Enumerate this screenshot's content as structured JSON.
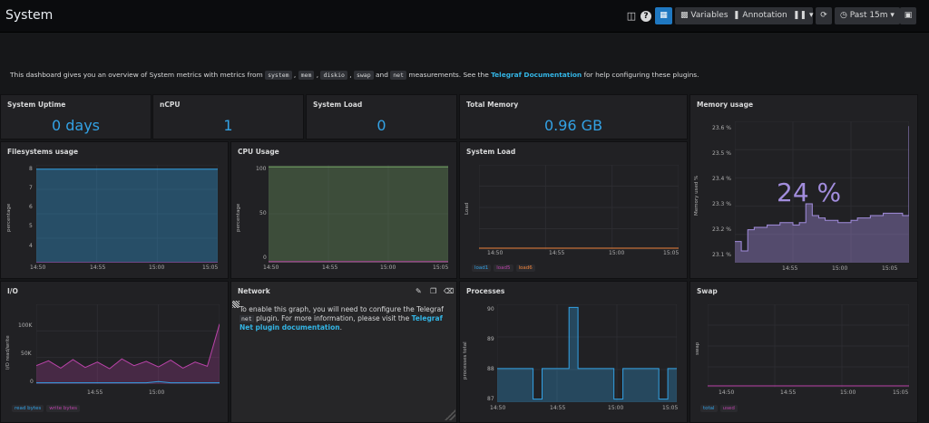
{
  "header": {
    "title": "System",
    "variables_label": "Variables",
    "annotations_label": "Annotations",
    "time_range": "Past 15m"
  },
  "intro": {
    "text_before": "This dashboard gives you an overview of System metrics with metrics from",
    "codes": [
      "system",
      "mem",
      "diskio",
      "swap",
      "net"
    ],
    "and": "and",
    "text_after": "measurements. See the",
    "link": "Telegraf Documentation",
    "text_end": "for help configuring these plugins."
  },
  "stats": {
    "uptime": {
      "title": "System Uptime",
      "value": "0 days"
    },
    "ncpu": {
      "title": "nCPU",
      "value": "1"
    },
    "load": {
      "title": "System Load",
      "value": "0"
    },
    "memory": {
      "title": "Total Memory",
      "value": "0.96 GB"
    }
  },
  "memory_usage": {
    "title": "Memory usage",
    "big_value": "24 %",
    "ylabel": "Memory used %"
  },
  "filesystems": {
    "title": "Filesystems usage",
    "ylabel": "percentage"
  },
  "cpu": {
    "title": "CPU Usage",
    "ylabel": "percentage"
  },
  "sysload": {
    "title": "System Load",
    "ylabel": "Load",
    "legend": [
      "load1",
      "load5",
      "load6"
    ]
  },
  "io": {
    "title": "I/O",
    "ylabel": "I/O read/write",
    "legend": [
      "read bytes",
      "write bytes"
    ]
  },
  "network": {
    "title": "Network",
    "text1": "To enable this graph, you will need to configure the Telegraf",
    "code": "net",
    "text2": "plugin. For more information, please visit the",
    "link": "Telegraf Net plugin documentation",
    "end": "."
  },
  "processes": {
    "title": "Processes",
    "ylabel": "processes total"
  },
  "swap": {
    "title": "Swap",
    "ylabel": "swap",
    "legend": [
      "total",
      "used"
    ]
  },
  "colors": {
    "blue": "#33a2e5",
    "purple": "#a28ddd",
    "green": "#7eb26d",
    "magenta": "#ba43a9",
    "orange": "#ef843c"
  },
  "chart_data": [
    {
      "type": "area",
      "title": "Filesystems usage",
      "ylabel": "percentage",
      "x": [
        "14:50",
        "14:55",
        "15:00",
        "15:05"
      ],
      "yticks": [
        "8",
        "7",
        "6",
        "5",
        "4"
      ],
      "ylim": [
        3.6,
        8.2
      ],
      "series": [
        {
          "values": [
            8,
            8,
            8,
            8
          ]
        },
        {
          "values": [
            3.6,
            3.6,
            3.6,
            3.6
          ]
        }
      ]
    },
    {
      "type": "area",
      "title": "CPU Usage",
      "ylabel": "percentage",
      "x": [
        "14:50",
        "14:55",
        "15:00",
        "15:05"
      ],
      "yticks": [
        "100",
        "50",
        "0"
      ],
      "ylim": [
        0,
        100
      ],
      "series": [
        {
          "values": [
            98,
            98,
            98,
            98
          ]
        },
        {
          "values": [
            1,
            1,
            1,
            1
          ]
        }
      ]
    },
    {
      "type": "line",
      "title": "System Load",
      "ylabel": "Load",
      "x": [
        "14:50",
        "14:55",
        "15:00",
        "15:05"
      ],
      "series": [
        {
          "name": "load1",
          "values": [
            0,
            0,
            0,
            0
          ]
        },
        {
          "name": "load5",
          "values": [
            0,
            0,
            0,
            0
          ]
        },
        {
          "name": "load6",
          "values": [
            0,
            0,
            0,
            0
          ]
        }
      ]
    },
    {
      "type": "area",
      "title": "Memory usage",
      "ylabel": "Memory used %",
      "x": [
        "14:55",
        "15:00",
        "15:05"
      ],
      "yticks": [
        "23.6 %",
        "23.5 %",
        "23.4 %",
        "23.3 %",
        "23.2 %",
        "23.1 %"
      ],
      "ylim": [
        23.05,
        23.65
      ],
      "values": [
        23.14,
        23.1,
        23.19,
        23.2,
        23.2,
        23.21,
        23.21,
        23.22,
        23.22,
        23.21,
        23.22,
        23.3,
        23.25,
        23.24,
        23.23,
        23.23,
        23.22,
        23.22,
        23.23,
        23.24,
        23.24,
        23.25,
        23.25,
        23.26,
        23.26,
        23.26,
        23.25,
        23.63
      ]
    },
    {
      "type": "line",
      "title": "I/O",
      "ylabel": "I/O read/write",
      "x": [
        "14:55",
        "15:00"
      ],
      "yticks": [
        "100K",
        "50K",
        "0"
      ],
      "ylim": [
        0,
        130000
      ],
      "series": [
        {
          "name": "read bytes",
          "values": [
            2000,
            2000,
            2000,
            2000,
            2000,
            2000,
            2000,
            2000,
            2000,
            2000,
            4000,
            2000,
            2000,
            2000,
            2000,
            2000
          ]
        },
        {
          "name": "write bytes",
          "values": [
            30000,
            38000,
            26000,
            40000,
            27000,
            36000,
            25000,
            41000,
            30000,
            37000,
            28000,
            39000,
            26000,
            36000,
            29000,
            98000
          ]
        }
      ]
    },
    {
      "type": "line",
      "title": "Processes",
      "ylabel": "processes total",
      "x": [
        "14:50",
        "14:55",
        "15:00",
        "15:05"
      ],
      "yticks": [
        "90",
        "89",
        "88",
        "87"
      ],
      "ylim": [
        86.9,
        90.1
      ],
      "values": [
        88,
        88,
        88,
        88,
        87,
        88,
        88,
        88,
        90,
        88,
        88,
        88,
        88,
        87,
        88,
        88,
        88,
        88,
        87,
        88,
        88
      ]
    },
    {
      "type": "line",
      "title": "Swap",
      "ylabel": "swap",
      "x": [
        "14:50",
        "14:55",
        "15:00",
        "15:05"
      ],
      "series": [
        {
          "name": "total",
          "values": [
            0,
            0,
            0,
            0
          ]
        },
        {
          "name": "used",
          "values": [
            0,
            0,
            0,
            0
          ]
        }
      ]
    }
  ]
}
